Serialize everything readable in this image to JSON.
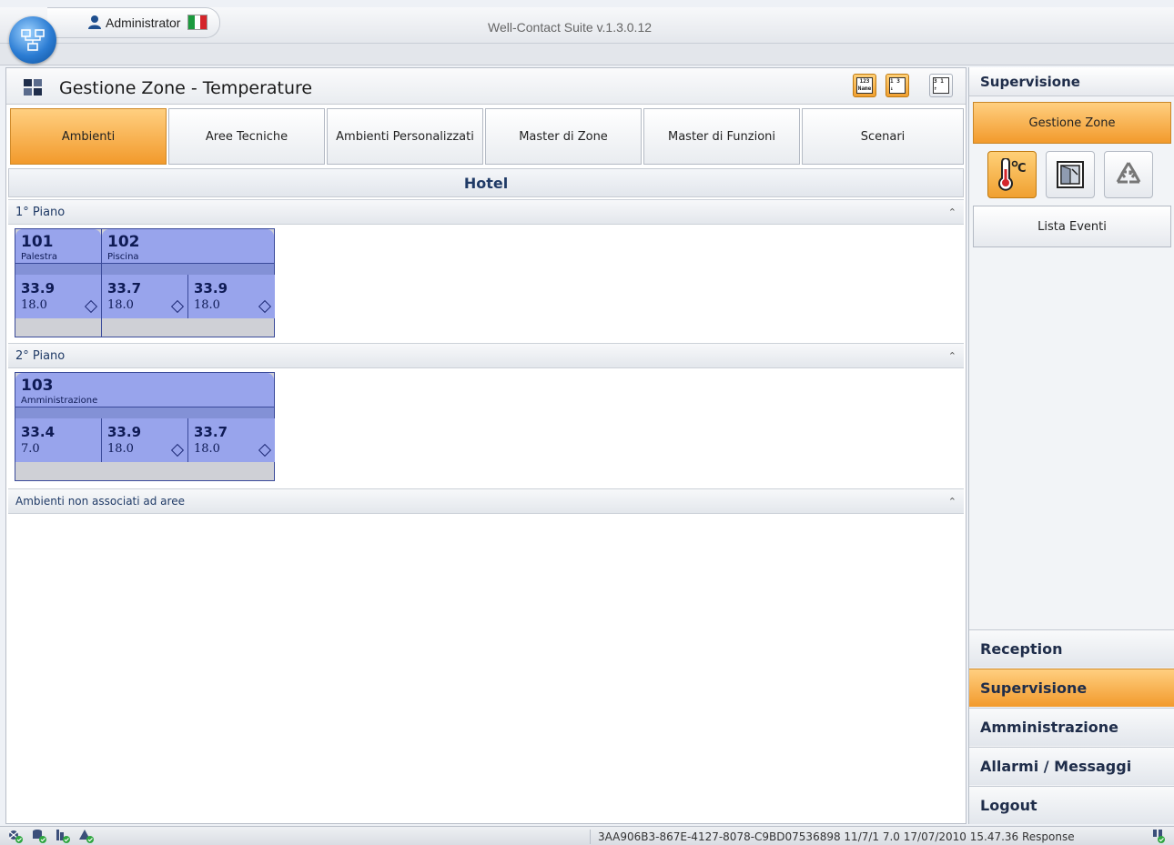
{
  "titlebar": {
    "user": "Administrator",
    "window_title": "Well-Contact Suite v.1.3.0.12",
    "flag_colors": [
      "#1c9a3e",
      "#ffffff",
      "#d4252a"
    ]
  },
  "header": {
    "title": "Gestione Zone - Temperature",
    "buttons": [
      {
        "label": "123 Name",
        "icon": "sort-by-name-icon",
        "active": true
      },
      {
        "label": "1 3 ↓",
        "icon": "sort-descending-icon",
        "active": true
      },
      {
        "label": "3 1 ↑",
        "icon": "sort-ascending-icon",
        "active": false
      }
    ]
  },
  "tabs": [
    {
      "label": "Ambienti",
      "active": true
    },
    {
      "label": "Aree Tecniche",
      "active": false
    },
    {
      "label": "Ambienti Personalizzati",
      "active": false
    },
    {
      "label": "Master di Zone",
      "active": false
    },
    {
      "label": "Master di Funzioni",
      "active": false
    },
    {
      "label": "Scenari",
      "active": false
    }
  ],
  "group": {
    "title": "Hotel"
  },
  "floors": [
    {
      "label": "1° Piano",
      "rooms": [
        {
          "number": "101",
          "name": "Palestra",
          "zones": [
            {
              "temp": "33.9",
              "setpoint": "18.0"
            }
          ]
        },
        {
          "number": "102",
          "name": "Piscina",
          "zones": [
            {
              "temp": "33.7",
              "setpoint": "18.0"
            },
            {
              "temp": "33.9",
              "setpoint": "18.0"
            }
          ]
        }
      ]
    },
    {
      "label": "2° Piano",
      "rooms": [
        {
          "number": "103",
          "name": "Amministrazione",
          "zones": [
            {
              "temp": "33.4",
              "setpoint": "7.0"
            },
            {
              "temp": "33.9",
              "setpoint": "18.0"
            },
            {
              "temp": "33.7",
              "setpoint": "18.0"
            }
          ]
        }
      ]
    }
  ],
  "unassigned": {
    "label": "Ambienti non associati ad aree"
  },
  "right_panel": {
    "title": "Supervisione",
    "gestione_zone": "Gestione Zone",
    "icons": [
      {
        "name": "thermometer-celsius-icon",
        "active": true
      },
      {
        "name": "window-icon",
        "active": false
      },
      {
        "name": "recycle-icon",
        "active": false
      }
    ],
    "lista_eventi": "Lista Eventi",
    "nav": [
      {
        "label": "Reception",
        "active": false
      },
      {
        "label": "Supervisione",
        "active": true
      },
      {
        "label": "Amministrazione",
        "active": false
      },
      {
        "label": "Allarmi / Messaggi",
        "active": false
      },
      {
        "label": "Logout",
        "active": false
      }
    ]
  },
  "statusbar": {
    "text": "3AA906B3-867E-4127-8078-C9BD07536898 11/7/1 7.0 17/07/2010 15.47.36 Response",
    "icons": [
      "network-ok-icon",
      "database-ok-icon",
      "device-ok-icon",
      "alarm-ok-icon"
    ]
  },
  "colors": {
    "accent_orange": "#f29a2c",
    "room_blue": "#98a4ec",
    "room_border": "#3a4a9a"
  }
}
